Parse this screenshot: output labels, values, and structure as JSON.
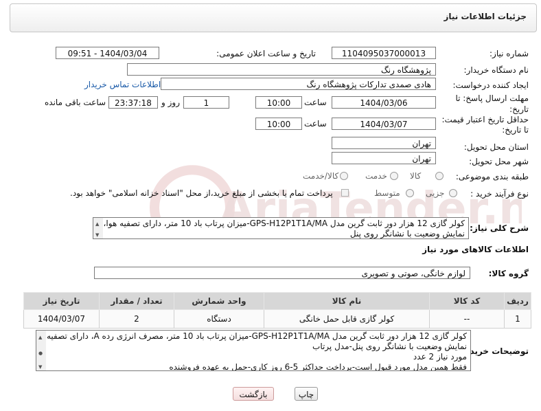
{
  "panel": {
    "title": "جزئیات اطلاعات نیاز"
  },
  "fields": {
    "need_number_label": "شماره نیاز:",
    "need_number": "1104095037000013",
    "announce_label": "تاریخ و ساعت اعلان عمومی:",
    "announce_value": "1404/03/04 - 09:51",
    "buyer_org_label": "نام دستگاه خریدار:",
    "buyer_org": "پژوهشگاه رنگ",
    "creator_label": "ایجاد کننده درخواست:",
    "creator": "هادی صمدی تدارکات پژوهشگاه رنگ",
    "contact_link": "اطلاعات تماس خریدار",
    "deadline_label_1": "مهلت ارسال پاسخ: تا",
    "deadline_label_2": "تاریخ:",
    "deadline_date": "1404/03/06",
    "time_label": "ساعت",
    "deadline_time": "10:00",
    "days_value": "1",
    "days_label": "روز و",
    "remaining_time": "23:37:18",
    "remaining_label": "ساعت باقی مانده",
    "min_price_label_1": "حداقل تاریخ اعتبار قیمت:",
    "min_price_label_2": "تا تاریخ:",
    "price_date": "1404/03/07",
    "price_time_label": "ساعت",
    "price_time": "10:00",
    "province_label": "استان محل تحویل:",
    "province": "تهران",
    "city_label": "شهر محل تحویل:",
    "city": "تهران",
    "category_label": "طبقه بندی موضوعی:",
    "category_options": [
      "کالا",
      "خدمت",
      "کالا/خدمت"
    ],
    "process_label": "نوع فرآیند خرید :",
    "process_options": [
      "جزیی",
      "متوسط"
    ],
    "payment_note": "پرداخت تمام یا بخشی از مبلغ خرید،از محل \"اسناد خزانه اسلامی\" خواهد بود."
  },
  "summary": {
    "label": "شرح کلی نیاز:",
    "text_line1": "کولر گازی 12 هزار دور ثابت گرین مدل GPS-H12P1T1A/MA-میزان پرتاب باد 10 متر، دارای تصفیه هوا،",
    "text_line2": "نمایش وضعیت با نشانگر روی پنل"
  },
  "goods": {
    "section_title": "اطلاعات کالاهای مورد نیاز",
    "group_label": "گروه کالا:",
    "group_value": "لوازم خانگی، صوتی و تصویری",
    "columns": [
      "ردیف",
      "کد کالا",
      "نام کالا",
      "واحد شمارش",
      "تعداد / مقدار",
      "تاریخ نیاز"
    ],
    "rows": [
      {
        "row": "1",
        "code": "--",
        "name": "کولر گازی قابل حمل خانگی",
        "unit": "دستگاه",
        "qty": "2",
        "date": "1404/03/07"
      }
    ]
  },
  "buyer_notes": {
    "label": "توضیحات خریدار:",
    "line1": "کولر گازی 12 هزار دور ثابت گرین مدل GPS-H12P1T1A/MA-میزان پرتاب باد 10 متر، مصرف انرژی رده A، دارای تصفیه هوا،",
    "line2": "نمایش وضعیت با نشانگر روی پنل-مدل پرتاب",
    "line3": "مورد نیاز 2 عدد",
    "line4": "فقط همین مدل مورد قبول است-پرداخت حداکثر 5-6 روز کاری-حمل به عهده فروشنده"
  },
  "buttons": {
    "print": "چاپ",
    "back": "بازگشت"
  },
  "watermark": "AriaTender.net",
  "colors": {
    "link": "#1a5aa8",
    "header_bg": "#d7d7d7",
    "watermark": "#e9c9c9"
  }
}
